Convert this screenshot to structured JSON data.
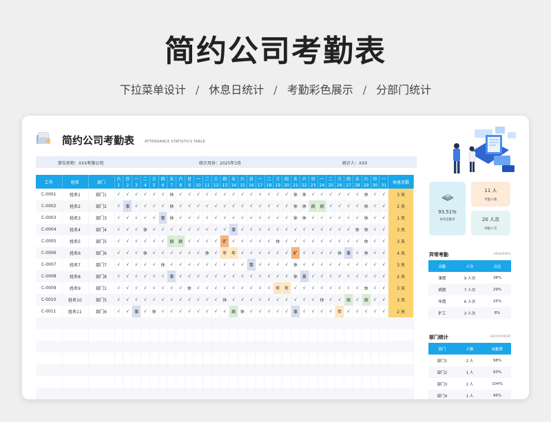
{
  "hero": {
    "title": "简约公司考勤表",
    "features": [
      "下拉菜单设计",
      "休息日统计",
      "考勤彩色展示",
      "分部门统计"
    ],
    "separator": "/"
  },
  "sheet": {
    "title": "简约公司考勤表",
    "subtitle": "ATTENDANCE STATISTICS TABLE",
    "company": "单位名称：XXX有限公司",
    "month": "统计月份：2025年3月",
    "person": "统计人：XXX"
  },
  "grid": {
    "headers": {
      "id": "工号",
      "name": "姓名",
      "dept": "部门",
      "rest": "休息天数"
    },
    "weekdays": [
      "六",
      "日",
      "一",
      "二",
      "三",
      "四",
      "五",
      "六",
      "日",
      "一",
      "二",
      "三",
      "四",
      "五",
      "六",
      "日",
      "一",
      "二",
      "三",
      "四",
      "五",
      "六",
      "日",
      "一",
      "二",
      "三",
      "四",
      "五",
      "六",
      "日",
      "一"
    ],
    "rows": [
      {
        "id": "C-0001",
        "name": "姓名1",
        "dept": "部门1",
        "marks": "√√√√√√休√√√√√√√√√√√√√休休√√√√√√休√√",
        "rest": "3 天"
      },
      {
        "id": "C-0002",
        "name": "姓名2",
        "dept": "部门2",
        "marks": "√事√√√√休√√√√√√√√√√√√√休休病病√√√√休√√",
        "rest": "2 天"
      },
      {
        "id": "C-0003",
        "name": "姓名3",
        "dept": "部门3",
        "marks": "√√√√√事休√√√√√√√√√√√√√休休√√√√√√休√√",
        "rest": "1 天"
      },
      {
        "id": "C-0004",
        "name": "姓名4",
        "dept": "部门4",
        "marks": "√√√休√√√√√√√√√事√√√√√√√√√√√√√休休√√",
        "rest": "3 天"
      },
      {
        "id": "C-0005",
        "name": "姓名5",
        "dept": "部门5",
        "marks": "√√√√√√病病√√√√旷√√√√√休√√√√√√√√√休√√",
        "rest": "3 天"
      },
      {
        "id": "C-0006",
        "name": "姓名6",
        "dept": "部门6",
        "marks": "√√√休√√√√√√休√年年√√√√√√旷√√√√休事√休√√",
        "rest": "4 天"
      },
      {
        "id": "C-0007",
        "name": "姓名7",
        "dept": "部门7",
        "marks": "√√√√√休√√√√√√√√√事√√√√休√√√√√√√√√√",
        "rest": "3 天"
      },
      {
        "id": "C-0008",
        "name": "姓名8",
        "dept": "部门8",
        "marks": "√√√√√√事√√√√√√√√√√√√√休事√√√√√√√√√",
        "rest": "2 天"
      },
      {
        "id": "C-0009",
        "name": "姓名9",
        "dept": "部门1",
        "marks": "√√√√√√√√休√√√√√√√√√年年√√√√√√√√休√√",
        "rest": "3 天"
      },
      {
        "id": "C-0010",
        "name": "姓名10",
        "dept": "部门5",
        "marks": "√√√√√√√√√√√√休√√√√√√√√√√休√√病√病√√",
        "rest": "3 天"
      },
      {
        "id": "C-0011",
        "name": "姓名11",
        "dept": "部门6",
        "marks": "√√事√休√√√√√√√√病休√√√√√事√√√√年√√√√√",
        "rest": "2 天"
      }
    ]
  },
  "stats": {
    "rate": "93.51%",
    "rate_label": "本月出勤率",
    "staff": "11 人",
    "staff_label": "考勤人数",
    "leave": "20 人次",
    "leave_label": "缺勤人次"
  },
  "abnormal": {
    "title": "异常考勤",
    "tag": "ABNORMAL",
    "headers": [
      "出勤",
      "人次",
      "占比"
    ],
    "rows": [
      [
        "事假",
        "9 人次",
        "38%"
      ],
      [
        "病假",
        "7 人次",
        "29%"
      ],
      [
        "年假",
        "6 人次",
        "25%"
      ],
      [
        "旷工",
        "2 人次",
        "8%"
      ]
    ]
  },
  "department": {
    "title": "部门统计",
    "tag": "DEPARTMENT",
    "headers": [
      "部门",
      "人数",
      "出勤率"
    ],
    "rows": [
      [
        "部门1",
        "2 人",
        "98%"
      ],
      [
        "部门2",
        "1 人",
        "93%"
      ],
      [
        "部门3",
        "1 人",
        "104%"
      ],
      [
        "部门4",
        "1 人",
        "96%"
      ]
    ]
  },
  "colors": {
    "accent": "#1aa6e8",
    "sick": "#d8ecd5",
    "affair": "#d6def0",
    "annual": "#fde6bf",
    "absent": "#f7b27b",
    "rest_count": "#fbd372"
  }
}
